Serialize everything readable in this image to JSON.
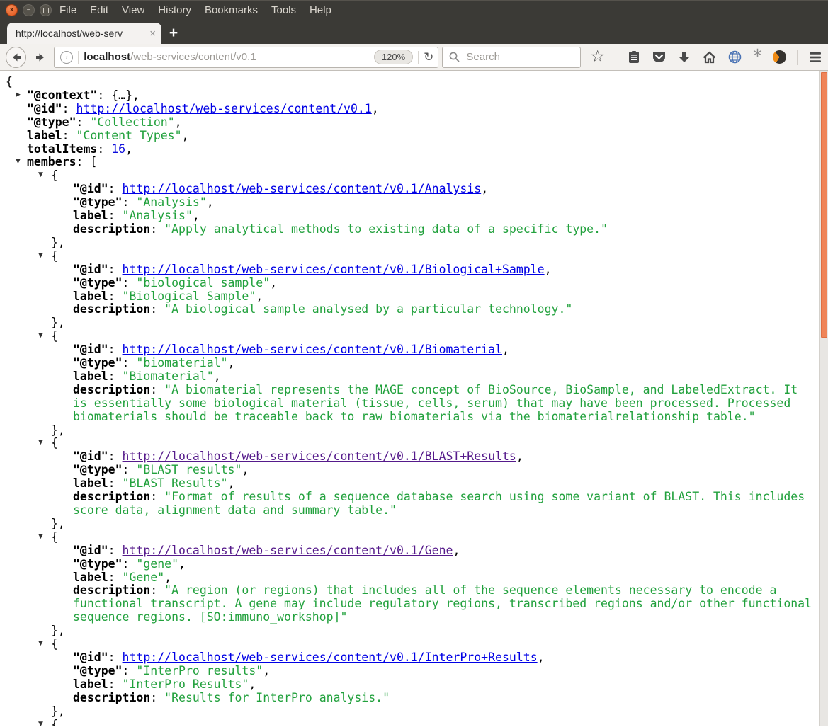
{
  "titlebar": {
    "close_glyph": "×",
    "min_glyph": "−"
  },
  "menu": [
    "File",
    "Edit",
    "View",
    "History",
    "Bookmarks",
    "Tools",
    "Help"
  ],
  "tabbar": {
    "tab_title": "http://localhost/web-serv",
    "close_glyph": "×",
    "new_tab_glyph": "+"
  },
  "navbar": {
    "info_glyph": "i",
    "url_domain": "localhost",
    "url_path": "/web-services/content/v0.1",
    "zoom_level": "120%",
    "reload_glyph": "↻",
    "search_placeholder": "Search",
    "star_glyph": "☆",
    "ext_splat_glyph": "*"
  },
  "colors": {
    "accent_orange": "#ef8458",
    "link": "#0000e5",
    "visited_link": "#551a8b",
    "json_string": "#22a13d",
    "json_number": "#0c0cdc"
  },
  "json": {
    "arrows": {
      "collapsed": "▶",
      "expanded": "▼"
    },
    "punct": {
      "open": "{",
      "close_comma": "},",
      "colon": ": ",
      "comma": ",",
      "collapsed_object": "{…}",
      "open_array": "["
    },
    "keys": {
      "context": "\"@context\"",
      "id": "\"@id\"",
      "type": "\"@type\"",
      "label": "label",
      "total": "totalItems",
      "members": "members",
      "description": "description"
    },
    "root": {
      "id_url": "http://localhost/web-services/content/v0.1",
      "type": "\"Collection\"",
      "label": "\"Content Types\"",
      "total": "16"
    },
    "members": [
      {
        "id_url": "http://localhost/web-services/content/v0.1/Analysis",
        "type": "\"Analysis\"",
        "label": "\"Analysis\"",
        "description": "\"Apply analytical methods to existing data of a specific type.\""
      },
      {
        "id_url": "http://localhost/web-services/content/v0.1/Biological+Sample",
        "type": "\"biological sample\"",
        "label": "\"Biological Sample\"",
        "description": "\"A biological sample analysed by a particular technology.\""
      },
      {
        "id_url": "http://localhost/web-services/content/v0.1/Biomaterial",
        "type": "\"biomaterial\"",
        "label": "\"Biomaterial\"",
        "description": "\"A biomaterial represents the MAGE concept of BioSource, BioSample, and LabeledExtract. It is essentially some biological material (tissue, cells, serum) that may have been processed. Processed biomaterials should be traceable back to raw biomaterials via the biomaterialrelationship table.\""
      },
      {
        "id_url": "http://localhost/web-services/content/v0.1/BLAST+Results",
        "type": "\"BLAST results\"",
        "label": "\"BLAST Results\"",
        "description": "\"Format of results of a sequence database search using some variant of BLAST. This includes score data, alignment data and summary table.\""
      },
      {
        "id_url": "http://localhost/web-services/content/v0.1/Gene",
        "type": "\"gene\"",
        "label": "\"Gene\"",
        "description": "\"A region (or regions) that includes all of the sequence elements necessary to encode a functional transcript. A gene may include regulatory regions, transcribed regions and/or other functional sequence regions. [SO:immuno_workshop]\""
      },
      {
        "id_url": "http://localhost/web-services/content/v0.1/InterPro+Results",
        "type": "\"InterPro results\"",
        "label": "\"InterPro Results\"",
        "description": "\"Results for InterPro analysis.\""
      }
    ]
  }
}
